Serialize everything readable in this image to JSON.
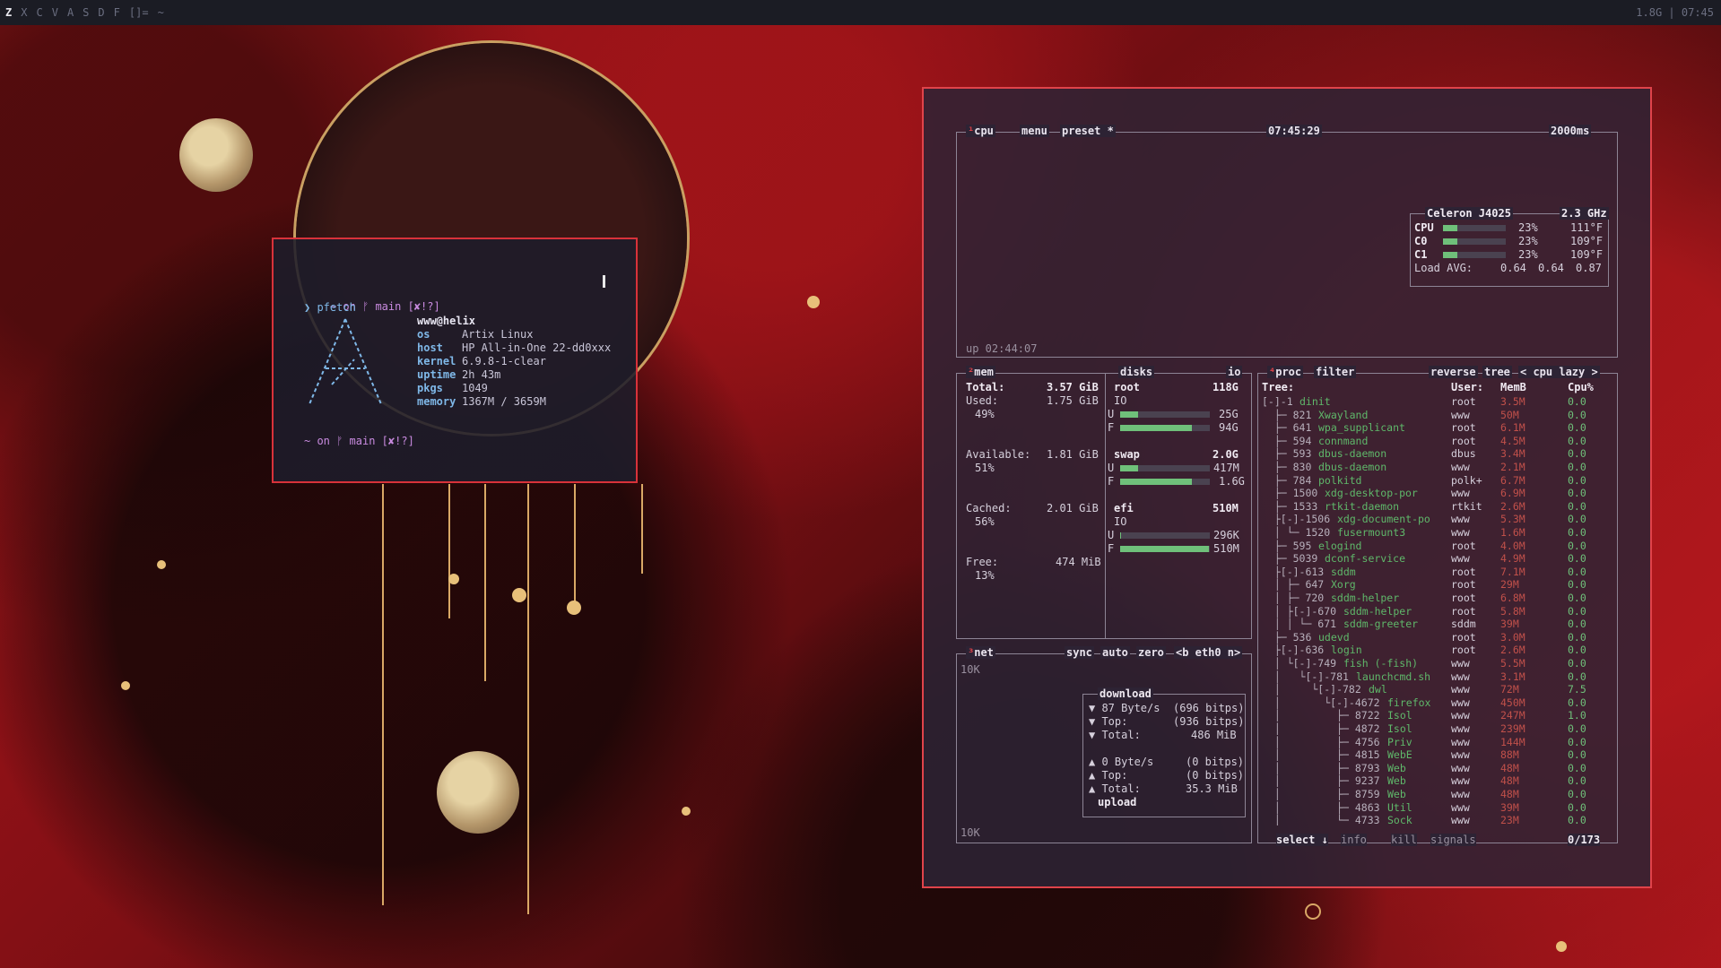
{
  "topbar": {
    "workspaces": [
      "Z",
      "X",
      "C",
      "V",
      "A",
      "S",
      "D",
      "F"
    ],
    "layout_icon": "[]=",
    "title": "~",
    "status": "1.8G | 07:45"
  },
  "terminal": {
    "prompt1": "~ on ᚠ main [✘!?]",
    "command": "❯ pfetch",
    "user": "www@helix",
    "fields": [
      {
        "key": "os",
        "val": "Artix Linux"
      },
      {
        "key": "host",
        "val": "HP All-in-One 22-dd0xxx"
      },
      {
        "key": "kernel",
        "val": "6.9.8-1-clear"
      },
      {
        "key": "uptime",
        "val": "2h 43m"
      },
      {
        "key": "pkgs",
        "val": "1049"
      },
      {
        "key": "memory",
        "val": "1367M / 3659M"
      }
    ],
    "prompt2": "~ on ᚠ main [✘!?]"
  },
  "btop": {
    "cpu_box": {
      "tab_num": "¹",
      "title": "cpu",
      "menu": "menu",
      "preset": "preset *",
      "clock": "07:45:29",
      "interval": "2000ms",
      "uptime": "up 02:44:07",
      "model": "Celeron J4025",
      "freq": "2.3 GHz",
      "rows": [
        {
          "name": "CPU",
          "pct": "23%",
          "temp": "111°F",
          "level": 0.23
        },
        {
          "name": "C0",
          "pct": "23%",
          "temp": "109°F",
          "level": 0.23
        },
        {
          "name": "C1",
          "pct": "23%",
          "temp": "109°F",
          "level": 0.23
        }
      ],
      "load_label": "Load AVG:",
      "load": [
        "0.64",
        "0.64",
        "0.87"
      ]
    },
    "mem_box": {
      "tab_num": "²",
      "title": "mem",
      "disks_title": "disks",
      "io_label": "io",
      "total_label": "Total:",
      "total": "3.57 GiB",
      "used_label": "Used:",
      "used": "1.75 GiB",
      "used_pct": "49%",
      "avail_label": "Available:",
      "avail": "1.81 GiB",
      "avail_pct": "51%",
      "cached_label": "Cached:",
      "cached": "2.01 GiB",
      "cached_pct": "56%",
      "free_label": "Free:",
      "free": "474 MiB",
      "free_pct": "13%",
      "disks": [
        {
          "name": "root",
          "size": "118G",
          "io": "IO",
          "u": "25G",
          "f": "94G",
          "u_level": 0.2,
          "f_level": 0.8
        },
        {
          "name": "swap",
          "size": "2.0G",
          "io": "",
          "u": "417M",
          "f": "1.6G",
          "u_level": 0.2,
          "f_level": 0.8
        },
        {
          "name": "efi",
          "size": "510M",
          "io": "IO",
          "u": "296K",
          "f": "510M",
          "u_level": 0.01,
          "f_level": 0.99
        }
      ]
    },
    "net_box": {
      "tab_num": "³",
      "title": "net",
      "sync": "sync",
      "auto": "auto",
      "zero": "zero",
      "iface": "<b eth0 n>",
      "scale_top": "10K",
      "scale_bottom": "10K",
      "download_title": "download",
      "download": [
        {
          "label": "▼ 87 Byte/s",
          "val": "(696 bitps)"
        },
        {
          "label": "▼ Top:",
          "val": "(936 bitps)"
        },
        {
          "label": "▼ Total:",
          "val": "486 MiB"
        }
      ],
      "upload": [
        {
          "label": "▲ 0 Byte/s",
          "val": "(0 bitps)"
        },
        {
          "label": "▲ Top:",
          "val": "(0 bitps)"
        },
        {
          "label": "▲ Total:",
          "val": "35.3 MiB"
        }
      ],
      "upload_title": "upload"
    },
    "proc_box": {
      "tab_num": "⁴",
      "title": "proc",
      "filter": "filter",
      "reverse": "reverse",
      "tree": "tree",
      "sort": "< cpu lazy >",
      "headers": {
        "tree": "Tree:",
        "user": "User:",
        "mem": "MemB",
        "cpu": "Cpu%"
      },
      "rows": [
        {
          "tree": "[-]-1 ",
          "name": "dinit",
          "user": "root",
          "mem": "3.5M",
          "cpu": "0.0"
        },
        {
          "tree": "  ├─ 821 ",
          "name": "Xwayland",
          "user": "www",
          "mem": "50M",
          "cpu": "0.0"
        },
        {
          "tree": "  ├─ 641 ",
          "name": "wpa_supplicant",
          "user": "root",
          "mem": "6.1M",
          "cpu": "0.0"
        },
        {
          "tree": "  ├─ 594 ",
          "name": "connmand",
          "user": "root",
          "mem": "4.5M",
          "cpu": "0.0"
        },
        {
          "tree": "  ├─ 593 ",
          "name": "dbus-daemon",
          "user": "dbus",
          "mem": "3.4M",
          "cpu": "0.0"
        },
        {
          "tree": "  ├─ 830 ",
          "name": "dbus-daemon",
          "user": "www",
          "mem": "2.1M",
          "cpu": "0.0"
        },
        {
          "tree": "  ├─ 784 ",
          "name": "polkitd",
          "user": "polk+",
          "mem": "6.7M",
          "cpu": "0.0"
        },
        {
          "tree": "  ├─ 1500 ",
          "name": "xdg-desktop-por",
          "user": "www",
          "mem": "6.9M",
          "cpu": "0.0"
        },
        {
          "tree": "  ├─ 1533 ",
          "name": "rtkit-daemon",
          "user": "rtkit",
          "mem": "2.6M",
          "cpu": "0.0"
        },
        {
          "tree": "  ├[-]-1506 ",
          "name": "xdg-document-po",
          "user": "www",
          "mem": "5.3M",
          "cpu": "0.0"
        },
        {
          "tree": "  │ └─ 1520 ",
          "name": "fusermount3",
          "user": "www",
          "mem": "1.6M",
          "cpu": "0.0"
        },
        {
          "tree": "  ├─ 595 ",
          "name": "elogind",
          "user": "root",
          "mem": "4.0M",
          "cpu": "0.0"
        },
        {
          "tree": "  ├─ 5039 ",
          "name": "dconf-service",
          "user": "www",
          "mem": "4.9M",
          "cpu": "0.0"
        },
        {
          "tree": "  ├[-]-613 ",
          "name": "sddm",
          "user": "root",
          "mem": "7.1M",
          "cpu": "0.0"
        },
        {
          "tree": "  │ ├─ 647 ",
          "name": "Xorg",
          "user": "root",
          "mem": "29M",
          "cpu": "0.0"
        },
        {
          "tree": "  │ ├─ 720 ",
          "name": "sddm-helper",
          "user": "root",
          "mem": "6.8M",
          "cpu": "0.0"
        },
        {
          "tree": "  │ ├[-]-670 ",
          "name": "sddm-helper",
          "user": "root",
          "mem": "5.8M",
          "cpu": "0.0"
        },
        {
          "tree": "  │ │ └─ 671 ",
          "name": "sddm-greeter",
          "user": "sddm",
          "mem": "39M",
          "cpu": "0.0"
        },
        {
          "tree": "  ├─ 536 ",
          "name": "udevd",
          "user": "root",
          "mem": "3.0M",
          "cpu": "0.0"
        },
        {
          "tree": "  ├[-]-636 ",
          "name": "login",
          "user": "root",
          "mem": "2.6M",
          "cpu": "0.0"
        },
        {
          "tree": "  │ └[-]-749 ",
          "name": "fish (-fish)",
          "user": "www",
          "mem": "5.5M",
          "cpu": "0.0"
        },
        {
          "tree": "  │   └[-]-781 ",
          "name": "launchcmd.sh",
          "user": "www",
          "mem": "3.1M",
          "cpu": "0.0"
        },
        {
          "tree": "  │     └[-]-782 ",
          "name": "dwl",
          "user": "www",
          "mem": "72M",
          "cpu": "7.5"
        },
        {
          "tree": "  │       └[-]-4672 ",
          "name": "firefox",
          "user": "www",
          "mem": "450M",
          "cpu": "0.0"
        },
        {
          "tree": "  │         ├─ 8722 ",
          "name": "Isol",
          "user": "www",
          "mem": "247M",
          "cpu": "1.0"
        },
        {
          "tree": "  │         ├─ 4872 ",
          "name": "Isol",
          "user": "www",
          "mem": "239M",
          "cpu": "0.0"
        },
        {
          "tree": "  │         ├─ 4756 ",
          "name": "Priv",
          "user": "www",
          "mem": "144M",
          "cpu": "0.0"
        },
        {
          "tree": "  │         ├─ 4815 ",
          "name": "WebE",
          "user": "www",
          "mem": "88M",
          "cpu": "0.0"
        },
        {
          "tree": "  │         ├─ 8793 ",
          "name": "Web",
          "user": "www",
          "mem": "48M",
          "cpu": "0.0"
        },
        {
          "tree": "  │         ├─ 9237 ",
          "name": "Web",
          "user": "www",
          "mem": "48M",
          "cpu": "0.0"
        },
        {
          "tree": "  │         ├─ 8759 ",
          "name": "Web",
          "user": "www",
          "mem": "48M",
          "cpu": "0.0"
        },
        {
          "tree": "  │         ├─ 4863 ",
          "name": "Util",
          "user": "www",
          "mem": "39M",
          "cpu": "0.0"
        },
        {
          "tree": "  │         └─ 4733 ",
          "name": "Sock",
          "user": "www",
          "mem": "23M",
          "cpu": "0.0"
        }
      ],
      "footer_select": "select ↓",
      "footer_info": "info",
      "footer_kill": "kill",
      "footer_signals": "signals",
      "count": "0/173"
    }
  },
  "colors": {
    "accent": "#e0434a",
    "green": "#6fc07a",
    "proc_name": "#5fb86a"
  }
}
